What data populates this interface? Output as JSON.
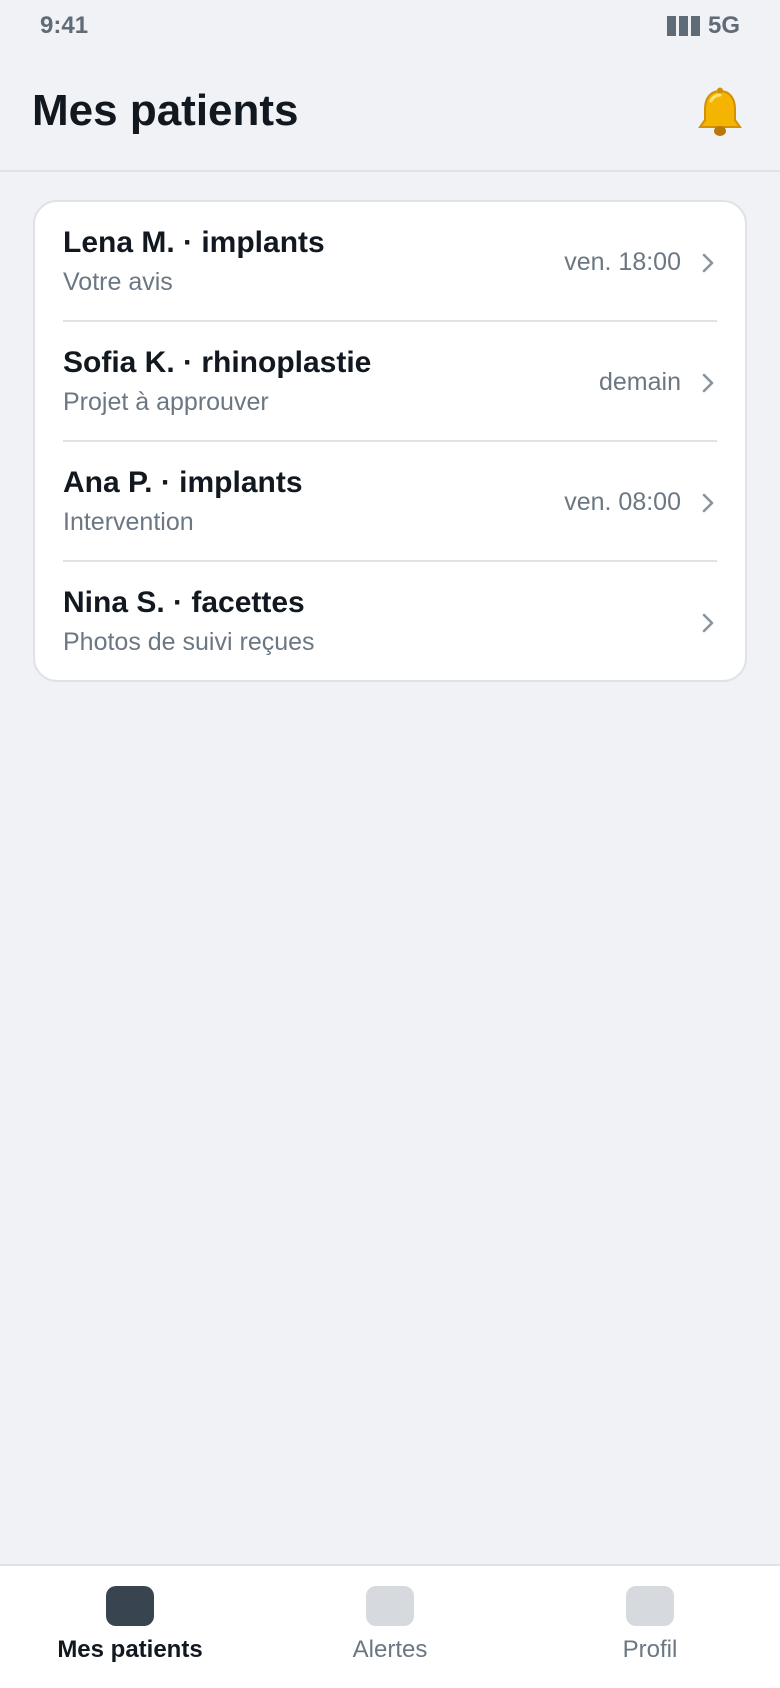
{
  "status_bar": {
    "time": "9:41",
    "network": "5G",
    "signal_icon": "signal-bars-icon"
  },
  "header": {
    "title": "Mes patients",
    "notification_icon": "bell-icon"
  },
  "patients": [
    {
      "title": "Lena M. · implants",
      "subtitle": "Votre avis",
      "meta": "ven. 18:00"
    },
    {
      "title": "Sofia K. · rhinoplastie",
      "subtitle": "Projet à approuver",
      "meta": "demain"
    },
    {
      "title": "Ana P. · implants",
      "subtitle": "Intervention",
      "meta": "ven. 08:00"
    },
    {
      "title": "Nina S. · facettes",
      "subtitle": "Photos de suivi reçues",
      "meta": ""
    }
  ],
  "tabs": [
    {
      "label": "Mes patients",
      "active": true
    },
    {
      "label": "Alertes",
      "active": false
    },
    {
      "label": "Profil",
      "active": false
    }
  ],
  "colors": {
    "background": "#f0f2f6",
    "title_text": "#12181f",
    "secondary_text": "#6b7782",
    "active_tab_icon": "#38444f",
    "inactive_tab_icon": "#d6d9dd",
    "bell": "#f5b400"
  }
}
